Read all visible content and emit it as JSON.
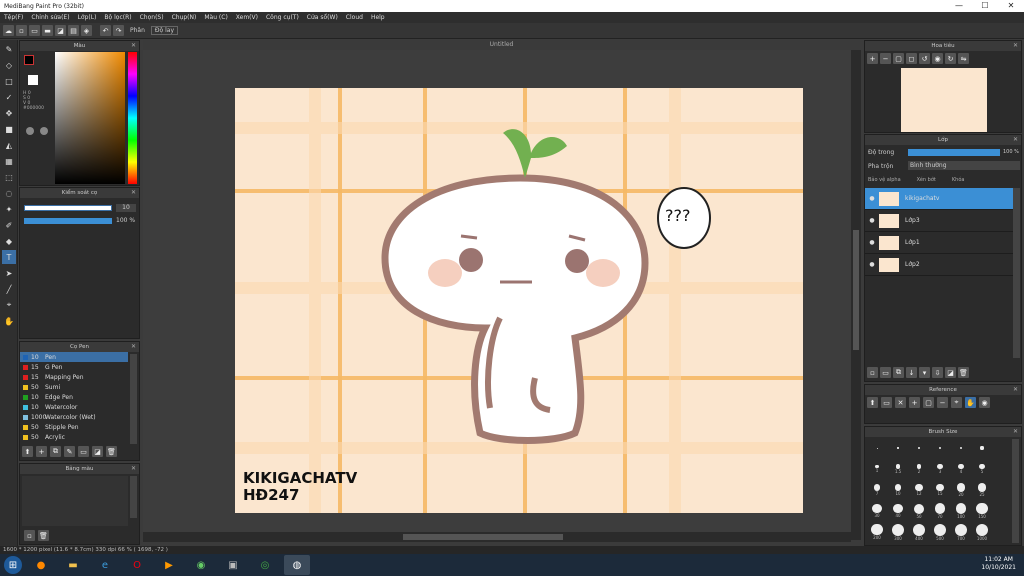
{
  "window": {
    "title": "MediBang Paint Pro (32bit)",
    "min": "—",
    "max": "☐",
    "close": "✕"
  },
  "menu": [
    "Tệp(F)",
    "Chỉnh sửa(E)",
    "Lớp(L)",
    "Bộ lọc(R)",
    "Chọn(S)",
    "Chụp(N)",
    "Màu (C)",
    "Xem(V)",
    "Công cụ(T)",
    "Cửa sổ(W)",
    "Cloud",
    "Help"
  ],
  "toolbar": {
    "label": "Phân",
    "vibration": "Độ lay"
  },
  "color_panel": {
    "title": "Màu",
    "h": "H 0",
    "s": "S 0",
    "v": "V 0",
    "hex": "#000000"
  },
  "brush_size_panel": {
    "title": "Kiểm soát cọ",
    "size": "10",
    "opacity": "100 %"
  },
  "pen_panel": {
    "title": "Cọ Pen",
    "items": [
      {
        "size": "10",
        "name": "Pen",
        "color": "#1e63b4",
        "active": true
      },
      {
        "size": "15",
        "name": "G Pen",
        "color": "#e02020",
        "active": false
      },
      {
        "size": "15",
        "name": "Mapping Pen",
        "color": "#e02020",
        "active": false
      },
      {
        "size": "50",
        "name": "Sumi",
        "color": "#f0c020",
        "active": false
      },
      {
        "size": "10",
        "name": "Edge Pen",
        "color": "#20a020",
        "active": false
      },
      {
        "size": "10",
        "name": "Watercolor",
        "color": "#40c0e0",
        "active": false
      },
      {
        "size": "1000",
        "name": "Watercolor (Wet)",
        "color": "#80c0e0",
        "active": false
      },
      {
        "size": "50",
        "name": "Stipple Pen",
        "color": "#f0c020",
        "active": false
      },
      {
        "size": "50",
        "name": "Acrylic",
        "color": "#f0c020",
        "active": false
      }
    ]
  },
  "layers_misc_panel": {
    "title": "Bảng màu"
  },
  "document": {
    "title": "Untitled"
  },
  "navigator": {
    "title": "Hoa tiêu"
  },
  "layer_panel": {
    "title": "Lớp",
    "opacity_label": "Độ trong",
    "opacity_value": "100 %",
    "blend_label": "Pha trộn",
    "blend_value": "Bình thường",
    "protect_alpha": "Bảo vệ alpha",
    "clipping": "Xén bớt",
    "lock": "Khóa",
    "layers": [
      {
        "name": "kikigachatv",
        "active": true
      },
      {
        "name": "Lớp3",
        "active": false
      },
      {
        "name": "Lớp1",
        "active": false
      },
      {
        "name": "Lớp2",
        "active": false
      }
    ]
  },
  "reference_panel": {
    "title": "Reference"
  },
  "brush_sizes_panel": {
    "title": "Brush Size",
    "sizes": [
      "",
      "",
      "",
      "",
      "",
      "",
      "1",
      "1.5",
      "2",
      "3",
      "4",
      "5",
      "7",
      "10",
      "12",
      "15",
      "20",
      "25",
      "30",
      "40",
      "50",
      "70",
      "100",
      "150",
      "200",
      "300",
      "400",
      "500",
      "700",
      "1000"
    ]
  },
  "canvas_text": {
    "line1": "KIKIGACHATV",
    "line2": "HĐ247"
  },
  "status": {
    "text": "1600 * 1200 pixel  (11.6 * 8.7cm)  330 dpi  66 %  ( 1698, -72 )"
  },
  "clock": {
    "time": "11:02 AM",
    "date": "10/10/2021"
  },
  "colors": {
    "accent": "#3b6fa5",
    "canvas_bg": "#fbe6cf",
    "plaid": "#f5b865",
    "outline": "#a27a70"
  }
}
